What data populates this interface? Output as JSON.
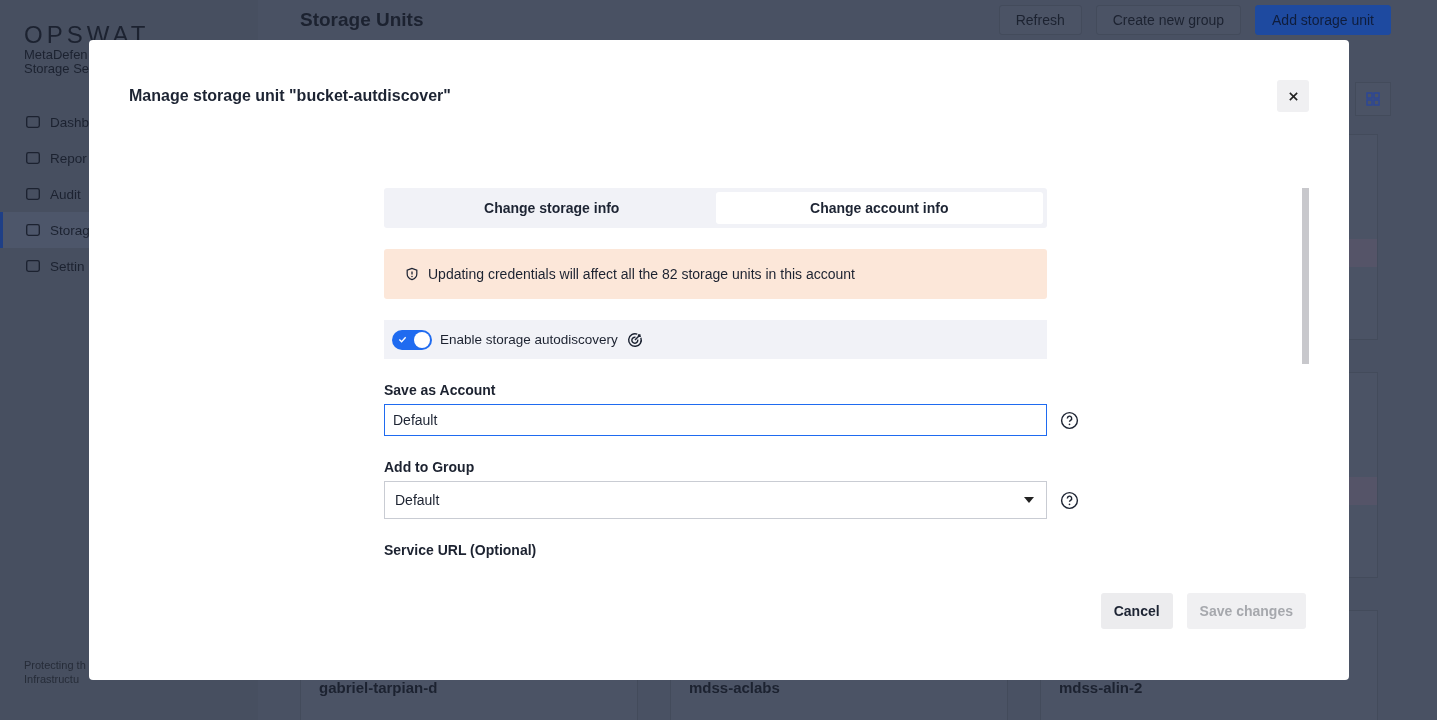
{
  "sidebar": {
    "logo": "OPSWAT",
    "product_lines": [
      "MetaDefen",
      "Storage Se"
    ],
    "items": [
      {
        "label": "Dashb",
        "selected": false
      },
      {
        "label": "Repor",
        "selected": false
      },
      {
        "label": "Audit",
        "selected": false
      },
      {
        "label": "Storag",
        "selected": true
      },
      {
        "label": "Settin",
        "selected": false
      }
    ],
    "footer_lines": [
      "Protecting th",
      "Infrastructu"
    ]
  },
  "page": {
    "title": "Storage Units",
    "buttons": [
      "Refresh",
      "Create new group",
      "Add storage unit"
    ],
    "cards": [
      {
        "title": "gabriel-tarpian-d"
      },
      {
        "title": "mdss-aclabs"
      },
      {
        "title": "mdss-alin-2"
      }
    ]
  },
  "dialog": {
    "title": "Manage storage unit \"bucket-autdiscover\"",
    "tabs": [
      {
        "label": "Change storage info",
        "selected": false
      },
      {
        "label": "Change account info",
        "selected": true
      }
    ],
    "alert": "Updating credentials will affect all the 82 storage units in this account",
    "autodiscovery": {
      "label": "Enable storage autodiscovery",
      "on": true
    },
    "fields": [
      {
        "kind": "text",
        "label": "Save as Account",
        "value": "Default"
      },
      {
        "kind": "select",
        "label": "Add to Group",
        "value": "Default"
      },
      {
        "kind": "text",
        "label": "Service URL (Optional)"
      }
    ],
    "buttons": [
      {
        "label": "Cancel",
        "disabled": false
      },
      {
        "label": "Save changes",
        "disabled": true
      }
    ]
  }
}
